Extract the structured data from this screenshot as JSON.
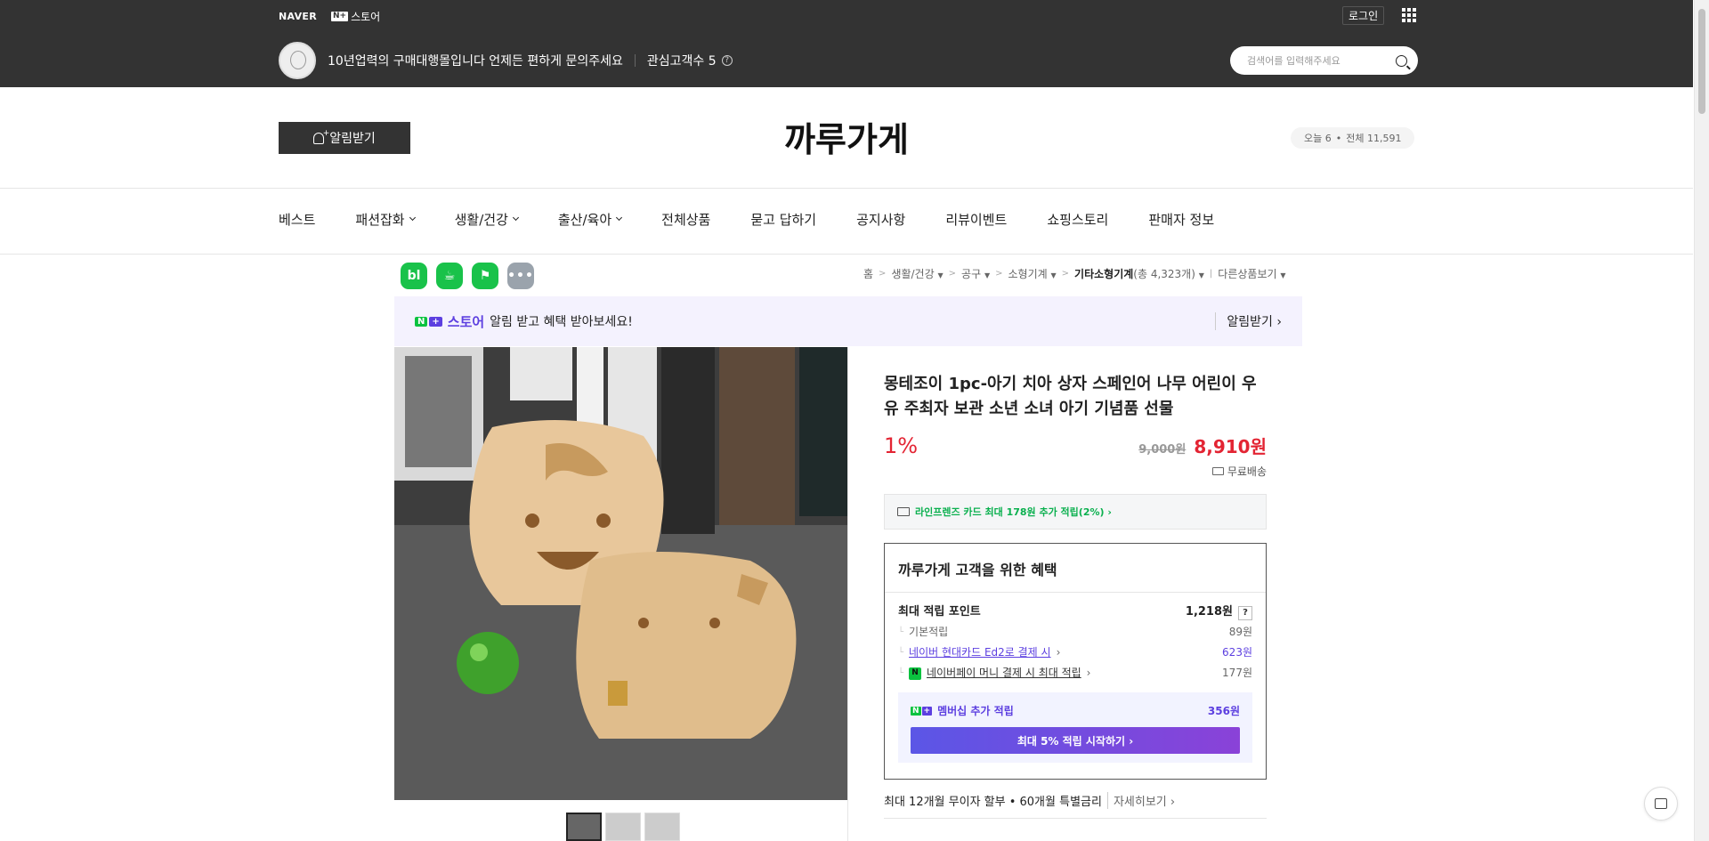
{
  "top": {
    "naver": "NAVER",
    "nstore_box": "N+",
    "nstore": "스토어",
    "login": "로그인"
  },
  "store": {
    "desc": "10년업력의 구매대행몰입니다 언제든 편하게 문의주세요",
    "fav": "관심고객수 5",
    "search_placeholder": "검색어를 입력해주세요",
    "alert_btn": "알림받기",
    "title": "까루가게",
    "visit_today": "오늘 6",
    "visit_total": "전체 11,591"
  },
  "nav": [
    {
      "label": "베스트",
      "dropdown": false,
      "light": false
    },
    {
      "label": "패션잡화",
      "dropdown": true,
      "light": false
    },
    {
      "label": "생활/건강",
      "dropdown": true,
      "light": false
    },
    {
      "label": "출산/육아",
      "dropdown": true,
      "light": false
    },
    {
      "label": "전체상품",
      "dropdown": false,
      "light": false
    },
    {
      "label": "묻고 답하기",
      "dropdown": false,
      "light": true
    },
    {
      "label": "공지사항",
      "dropdown": false,
      "light": true
    },
    {
      "label": "리뷰이벤트",
      "dropdown": false,
      "light": true
    },
    {
      "label": "쇼핑스토리",
      "dropdown": false,
      "light": true
    },
    {
      "label": "판매자 정보",
      "dropdown": false,
      "light": true
    }
  ],
  "share": {
    "blog": "bl",
    "more": "•••"
  },
  "breadcrumb": {
    "home": "홈",
    "c1": "생활/건강",
    "c2": "공구",
    "c3": "소형기계",
    "c4": "기타소형기계",
    "c4_count": "(총 4,323개)",
    "other": "다른상품보기"
  },
  "promo": {
    "n": "N",
    "plus": "+",
    "store": "스토어",
    "msg": "알림 받고 혜택 받아보세요!",
    "action": "알림받기 ›"
  },
  "product": {
    "title": "몽테조이 1pc-아기 치아 상자 스페인어 나무 어린이 우유 주최자 보관 소년 소녀 아기 기념품 선물",
    "discount": "1%",
    "original_price": "9,000원",
    "sale_price": "8,910원",
    "shipping": "무료배송",
    "card_benefit": "라인프렌즈 카드 최대 178원 추가 적립(2%) ›",
    "benefit_title": "까루가게 고객을 위한 혜택",
    "max_points_label": "최대 적립 포인트",
    "max_points": "1,218원",
    "basic_label": "기본적립",
    "basic_value": "89원",
    "hyundai_label": "네이버 현대카드 Ed2로 결제 시",
    "hyundai_value": "623원",
    "npay_label": "네이버페이 머니 결제 시 최대 적립",
    "npay_value": "177원",
    "membership_label": "멤버십 추가 적립",
    "membership_value": "356원",
    "membership_cta": "최대 5% 적립 시작하기 ›",
    "installment": "최대 12개월 무이자 할부 • 60개월 특별금리",
    "installment_more": "자세히보기 ›"
  },
  "colors": {
    "header_bg": "#333333",
    "sale_red": "#e32433",
    "naver_green": "#0bc23f",
    "plus_purple": "#5c3fe0"
  }
}
